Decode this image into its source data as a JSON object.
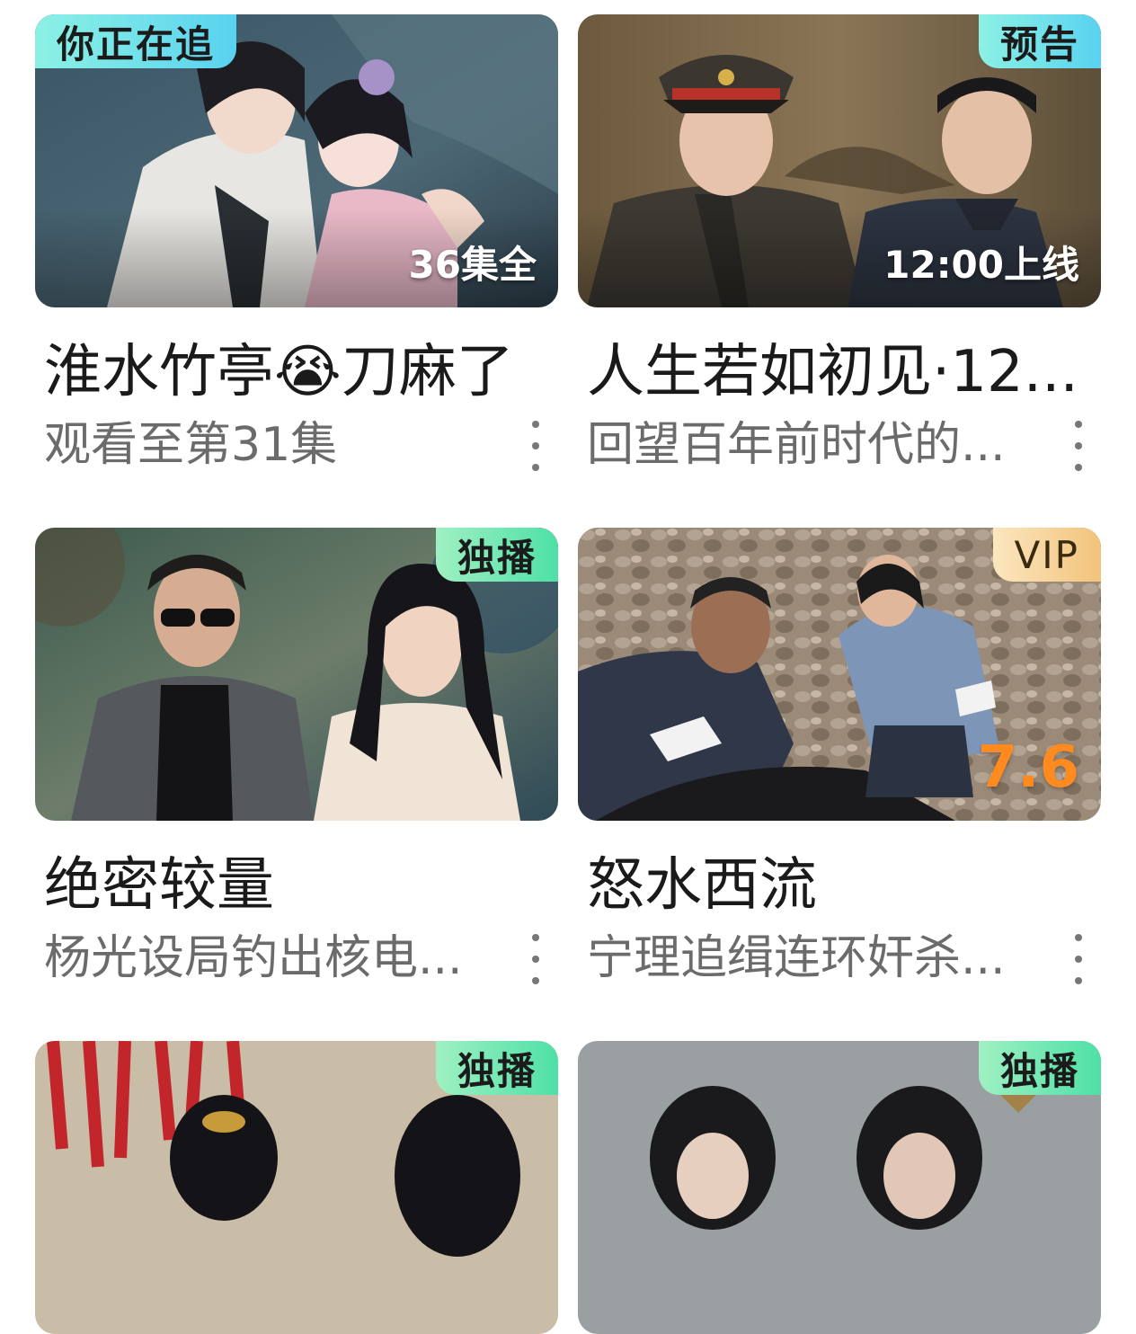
{
  "cards": [
    {
      "badge": "你正在追",
      "overlay": "36集全",
      "title": "淮水竹亭😭刀麻了",
      "subtitle": "观看至第31集"
    },
    {
      "badge": "预告",
      "overlay": "12:00上线",
      "title": "人生若如初见·12...",
      "subtitle": "回望百年前时代的..."
    },
    {
      "badge": "独播",
      "title": "绝密较量",
      "subtitle": "杨光设局钓出核电..."
    },
    {
      "badge": "VIP",
      "score": "7.6",
      "title": "怒水西流",
      "subtitle": "宁理追缉连环奸杀..."
    },
    {
      "badge": "独播"
    },
    {
      "badge": "独播"
    }
  ]
}
